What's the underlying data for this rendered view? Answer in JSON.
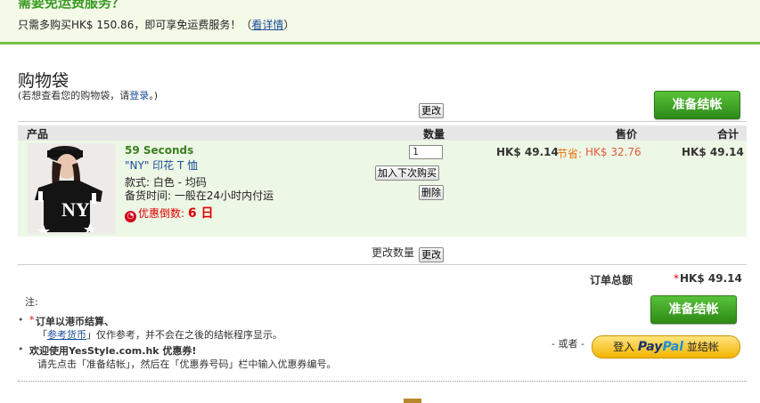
{
  "banner": {
    "title": "需要免运费服务？",
    "text_prefix": "只需多购买HK$ 150.86，即可享免运费服务！（",
    "link": "看详情",
    "text_suffix": "）"
  },
  "bag": {
    "title": "购物袋",
    "sub_prefix": "(若想查看您的购物袋，请",
    "sub_link": "登录",
    "sub_suffix": "。)",
    "checkout_label": "准备结帐",
    "update_label": "更改"
  },
  "table": {
    "headers": {
      "product": "产品",
      "qty": "数量",
      "price": "售价",
      "total": "合计"
    },
    "item": {
      "brand": "59 Seconds",
      "name": "\"NY\" 印花 T 恤",
      "style": "款式: 白色 - 均码",
      "stock": "备货时间: 一般在24小时内付运",
      "promo_label": "优惠倒数: ",
      "promo_days": "6 日",
      "qty": "1",
      "save_later": "加入下次购买",
      "delete": "删除",
      "price": "HK$ 49.14",
      "save_label": "节省: ",
      "save_amount": "HK$ 32.76",
      "total": "HK$ 49.14"
    },
    "update_qty_label": "更改数量",
    "update_label": "更改"
  },
  "summary": {
    "total_label": "订单总额",
    "asterisk": "*",
    "total_value": "HK$ 49.14",
    "checkout_label": "准备结帐",
    "or_label": "- 或者 -",
    "paypal_prefix": "登入",
    "paypal_pay": "Pay",
    "paypal_pal": "Pal",
    "paypal_suffix": "並结帐"
  },
  "notes": {
    "label": "注:",
    "n1_asterisk": "*",
    "n1_title": "订单以港币结算、",
    "n1_pre": "「",
    "n1_link": "参考货币",
    "n1_post": "」仅作参考，并不会在之後的结帐程序显示。",
    "n2_title": "欢迎使用YesStyle.com.hk 优惠券!",
    "n2_text": "请先点击「准备结帐」，然后在「优惠券号码」栏中输入优惠券编号。"
  },
  "colors": {
    "accent_green": "#7ac143",
    "link_blue": "#1a4d99",
    "sale_orange": "#e8720c",
    "promo_red": "#d00000"
  }
}
